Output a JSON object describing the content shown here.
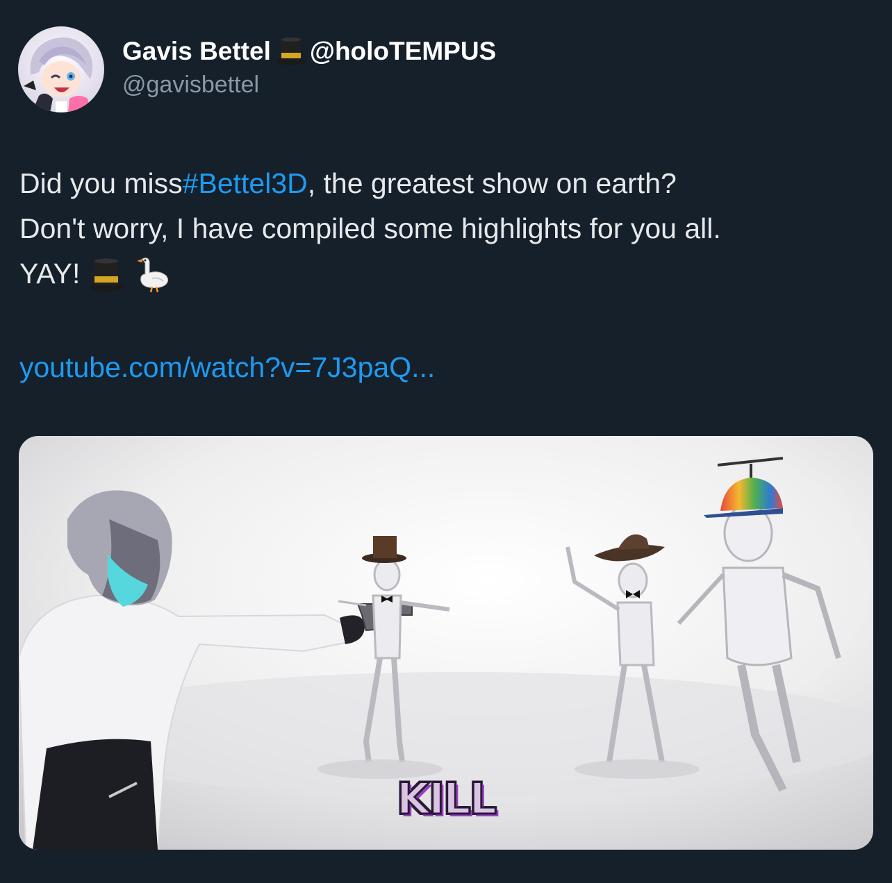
{
  "author": {
    "display_name": "Gavis Bettel",
    "name_suffix": "@holoTEMPUS",
    "handle": "@gavisbettel",
    "name_emoji": "top-hat-icon"
  },
  "tweet": {
    "line1_pre": "Did you miss ",
    "hashtag": "#Bettel3D",
    "line1_post": ", the greatest show on earth?",
    "line2": "Don't worry, I have compiled some highlights for you all.",
    "line3": "YAY!",
    "line3_emojis": [
      "top-hat-icon",
      "goose-icon"
    ],
    "link_text": "youtube.com/watch?v=7J3paQ..."
  },
  "media": {
    "caption": "KILL"
  },
  "colors": {
    "background": "#15202b",
    "text": "#e7e9ea",
    "secondary": "#8b98a5",
    "link": "#1d9bf0",
    "caption_fill": "#d9c4e2",
    "caption_shadow": "#9a3ec0"
  }
}
